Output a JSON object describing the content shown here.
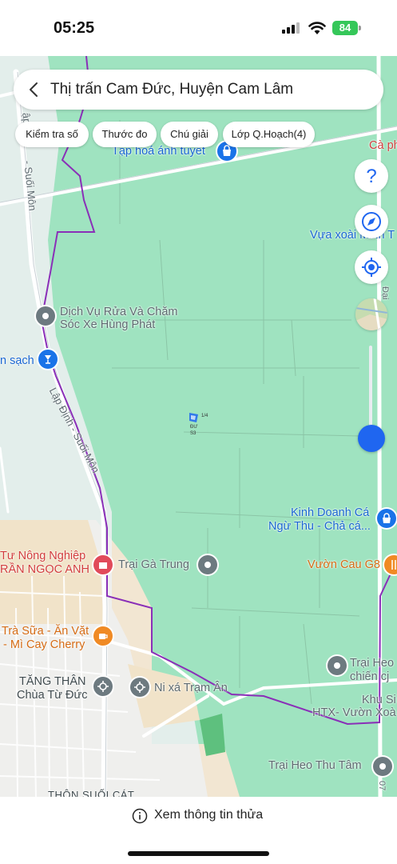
{
  "status_bar": {
    "time": "05:25",
    "battery": "84"
  },
  "search": {
    "title": "Thị trấn Cam Đức, Huyện Cam Lâm"
  },
  "chips": [
    {
      "label": "Kiểm tra số"
    },
    {
      "label": "Thước đo"
    },
    {
      "label": "Chú giải"
    },
    {
      "label": "Lớp Q.Hoạch(4)"
    }
  ],
  "side_buttons": [
    "help-icon",
    "compass-icon",
    "my-location-icon",
    "layer-thumbnail"
  ],
  "places": {
    "tap_hoa": "Tạp hoá ánh tuyết",
    "ca_phe": "Cà ph",
    "vua_xoai": "Vựa xoài Minh T",
    "rua_xe_1": "Dịch Vụ Rửa Và Chăm",
    "rua_xe_2": "Sóc Xe Hùng Phát",
    "n_sach": "n sạch",
    "kinh_doanh_1": "Kinh Doanh Cá",
    "kinh_doanh_2": "Ngừ Thu - Chả cá...",
    "nong_nghiep_1": "Tư Nông Nghiệp",
    "nong_nghiep_2": "RẦN NGỌC ANH",
    "trai_ga": "Trại Gà Trung",
    "vuon_cau": "Vườn Cau G8",
    "tra_sua_1": "Trà Sữa - Ăn Vặt",
    "tra_sua_2": "- Mì Cay Cherry",
    "tang_than_1": "TĂNG THÂN",
    "tang_than_2": "Chùa Từ Đức",
    "ni_xa": "Ni xá Trạm Ân",
    "trai_heo_1": "Trại Heo",
    "trai_heo_2": "chiến cj",
    "htx_1": "Khu Si",
    "htx_2": "HTX- Vườn Xoà",
    "trai_heo_thu_tam": "Trại Heo Thu Tâm",
    "thon": "THÔN SUỐI CÁT"
  },
  "roads": {
    "suoi_mon_v": "- Suối Môn",
    "lap_dinh": "Lập Định - Suối Môn",
    "ap": "ập",
    "dai": "Đại",
    "road07": "07"
  },
  "parcel": {
    "line1": "1/4",
    "line2": "ĐƯ",
    "line3": "S3"
  },
  "bottom": {
    "info_label": "Xem thông tin thửa"
  },
  "colors": {
    "map_bg": "#9fe3c0",
    "boundary": "#8a2fb8",
    "accent": "#1f66f0"
  }
}
